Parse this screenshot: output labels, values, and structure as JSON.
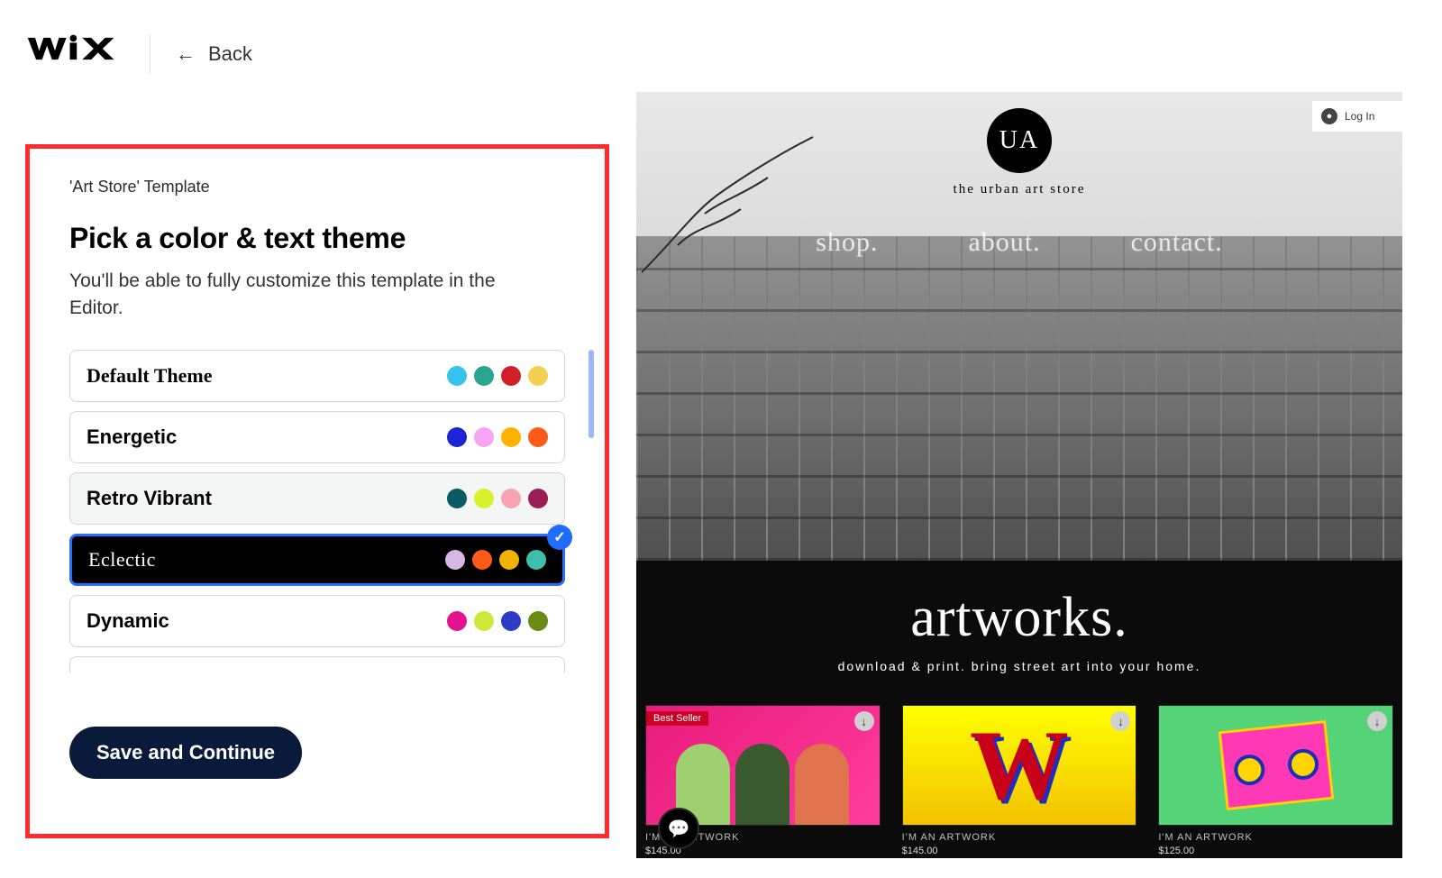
{
  "header": {
    "logo_text": "WIX",
    "back_label": "Back"
  },
  "panel": {
    "breadcrumb": "'Art Store' Template",
    "title": "Pick a color & text theme",
    "subtitle": "You'll be able to fully customize this template in the Editor.",
    "save_label": "Save and Continue",
    "themes": [
      {
        "name": "Default Theme",
        "swatches": [
          "#36c3ee",
          "#2aa58f",
          "#d31f2a",
          "#f3cf52"
        ],
        "style": "serif"
      },
      {
        "name": "Energetic",
        "swatches": [
          "#1c24d6",
          "#f6a5f2",
          "#ffb300",
          "#ff5a17"
        ],
        "style": "sans"
      },
      {
        "name": "Retro Vibrant",
        "swatches": [
          "#0a5964",
          "#d7f22b",
          "#f6a3b5",
          "#9b1d55"
        ],
        "style": "sans",
        "soft": true
      },
      {
        "name": "Eclectic",
        "swatches": [
          "#d7b6e8",
          "#ff5a17",
          "#f2b300",
          "#3fbfa9"
        ],
        "style": "light",
        "selected": true
      },
      {
        "name": "Dynamic",
        "swatches": [
          "#e11390",
          "#cfe93a",
          "#2d3cc5",
          "#6a8a11"
        ],
        "style": "sans"
      }
    ]
  },
  "preview": {
    "login_label": "Log In",
    "badge": "UA",
    "tagline": "the urban art store",
    "menu": [
      "shop.",
      "about.",
      "contact."
    ],
    "artworks_title": "artworks.",
    "artworks_sub": "download & print. bring street art into your home.",
    "best_seller": "Best Seller",
    "products": [
      {
        "name": "I'M AN ARTWORK",
        "price": "$145.00"
      },
      {
        "name": "I'M AN ARTWORK",
        "price": "$145.00"
      },
      {
        "name": "I'M AN ARTWORK",
        "price": "$125.00"
      }
    ]
  }
}
